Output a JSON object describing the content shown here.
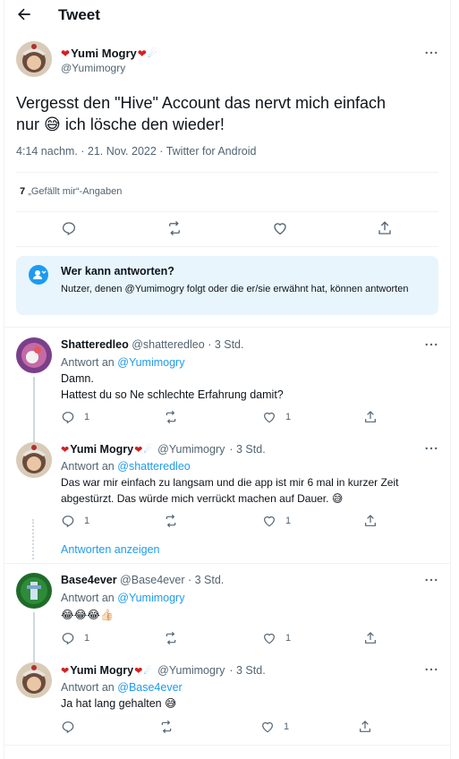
{
  "header": {
    "title": "Tweet"
  },
  "tweet": {
    "name": "Yumi Mogry",
    "handle": "@Yumimogry",
    "text_part1": "Vergesst den \"Hive\" Account das nervt mich einfach",
    "text_part2_before": "nur",
    "text_part2_after": "ich lösche den wieder!",
    "meta": "4:14 nachm. · 21. Nov. 2022 · Twitter for Android",
    "likes_count": "7",
    "likes_label": "„Gefällt mir“-Angaben"
  },
  "who_can_reply": {
    "title": "Wer kann antworten?",
    "text": "Nutzer, denen @Yumimogry folgt oder die er/sie erwähnt hat, können antworten"
  },
  "replies": [
    {
      "name": "Shatteredleo",
      "handle": "@shatteredleo",
      "time": "· 3 Std.",
      "reply_prefix": "Antwort an",
      "reply_to": "@Yumimogry",
      "line1": "Damn.",
      "line2": "Hattest du so Ne schlechte Erfahrung damit?",
      "comments": "1",
      "likes": "1"
    },
    {
      "name": "Yumi Mogry",
      "handle": "@Yumimogry",
      "time": "· 3 Std.",
      "reply_prefix": "Antwort an",
      "reply_to": "@shatteredleo",
      "line1": "Das war mir einfach zu langsam und die app ist mir 6 mal in kurzer Zeit",
      "line2": "abgestürzt. Das würde mich verrückt machen auf Dauer.",
      "comments": "1",
      "likes": "1"
    },
    {
      "name": "Base4ever",
      "handle": "@Base4ever",
      "time": "· 3 Std.",
      "reply_prefix": "Antwort an",
      "reply_to": "@Yumimogry",
      "line1": "😂😂😂👍🏻",
      "comments": "1",
      "likes": "1"
    },
    {
      "name": "Yumi Mogry",
      "handle": "@Yumimogry",
      "time": "· 3 Std.",
      "reply_prefix": "Antwort an",
      "reply_to": "@Base4ever",
      "line1": "Ja hat lang gehalten",
      "likes": "1"
    }
  ],
  "show_replies": "Antworten anzeigen",
  "colors": {
    "accent": "#1d9bf0",
    "text": "#0f1419",
    "muted": "#536471",
    "border": "#eff3f4",
    "info_bg": "#e8f5fd"
  }
}
